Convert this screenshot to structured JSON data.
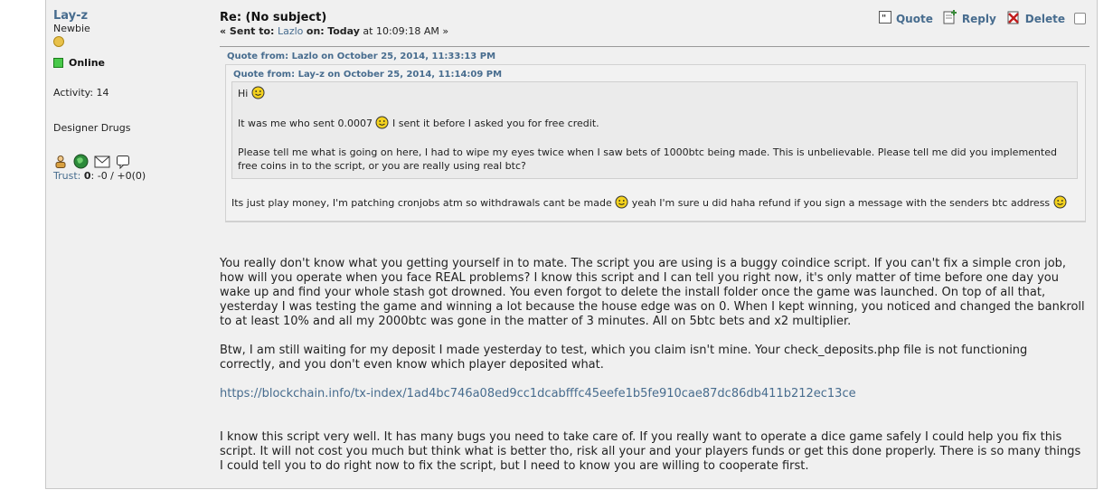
{
  "poster": {
    "name": "Lay-z",
    "rank": "Newbie",
    "status": "Online",
    "activity": "Activity: 14",
    "custom_title": "Designer Drugs",
    "trust_label": "Trust:",
    "trust_value": "0",
    "trust_rest": ": -0 / +0(0)"
  },
  "message": {
    "subject": "Re: (No subject)",
    "sent_prefix": "« Sent to:",
    "recipient": "Lazlo",
    "on_label": "on:",
    "date_bold": "Today",
    "date_rest": "at 10:09:18 AM »"
  },
  "actions": {
    "quote": "Quote",
    "reply": "Reply",
    "delete": "Delete"
  },
  "outer_quote": {
    "header": "Quote from: Lazlo on October 25, 2014, 11:33:13 PM",
    "inner_quote": {
      "header": "Quote from: Lay-z on October 25, 2014, 11:14:09 PM",
      "line1": "Hi",
      "line2a": "It was me who sent 0.0007",
      "line2b": "I sent it before I asked you for free credit.",
      "line3": "Please tell me what is going on here, I had to wipe my eyes twice when I saw bets of 1000btc being made. This is unbelievable. Please tell me did you implemented free coins in to the script, or you are really using real btc?"
    },
    "text_a": "Its just play money, I'm patching cronjobs atm so withdrawals cant be made",
    "text_b": "yeah I'm sure u did haha refund if you sign a message with the senders btc address"
  },
  "body": {
    "p1": "You really don't know what you getting yourself in to mate. The script you are using is a buggy coindice script. If you can't fix a simple cron job, how will you operate when you face REAL problems? I know this script and I can tell you right now, it's only matter of time before one day you wake up and find your whole stash got drowned. You even forgot to delete the install folder once the game was launched. On top of all that, yesterday I was testing the game and winning a lot because the house edge was on 0. When I kept winning, you noticed and changed the bankroll to at least 10% and all my 2000btc was gone in the matter of 3 minutes. All on 5btc bets and x2 multiplier.",
    "p2": "Btw, I am still waiting for my deposit I made yesterday to test, which you claim isn't mine. Your check_deposits.php file is not functioning correctly, and you don't even know which player deposited what.",
    "link": "https://blockchain.info/tx-index/1ad4bc746a08ed9cc1dcabfffc45eefe1b5fe910cae87dc86db411b212ec13ce",
    "p3": "I know this script very well. It has many bugs you need to take care of. If you really want to operate a dice game safely I could help you fix this script. It will not cost you much but think what is better tho, risk all your and your players funds or get this done properly. There is so many things I could tell you to do right now to fix the script, but I need to know you are willing to cooperate first."
  },
  "icons": [
    "rank-star-icon",
    "online-status-icon",
    "profile-icon",
    "website-globe-icon",
    "email-icon",
    "personal-message-icon",
    "quote-icon",
    "reply-icon",
    "delete-icon",
    "smiley-icon"
  ],
  "colors": {
    "link": "#476c8e",
    "background": "#f0f0f0",
    "online": "#49c94a"
  }
}
